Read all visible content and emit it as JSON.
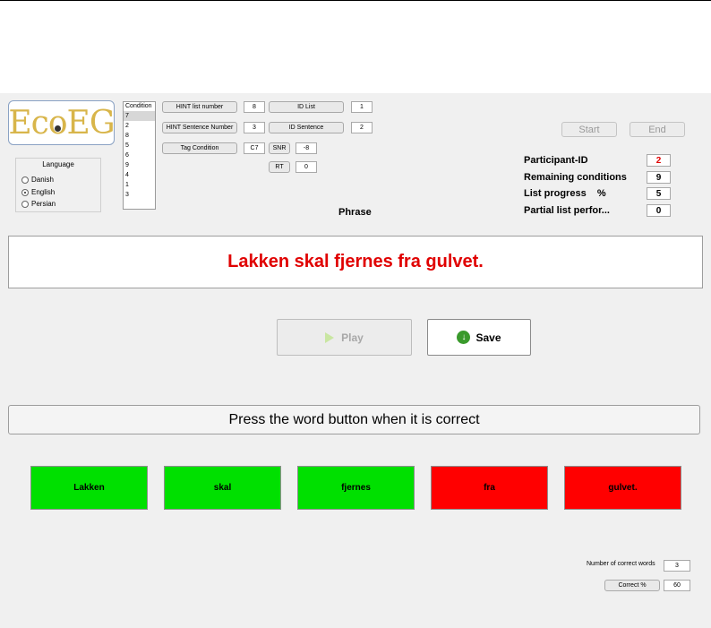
{
  "logo": {
    "text_left": "Ec",
    "text_mid": "o",
    "text_right": "EG"
  },
  "language": {
    "title": "Language",
    "options": [
      {
        "label": "Danish",
        "selected": false
      },
      {
        "label": "English",
        "selected": true
      },
      {
        "label": "Persian",
        "selected": false
      }
    ]
  },
  "conditions": {
    "header": "Condition",
    "selected": "7",
    "items": [
      "2",
      "8",
      "5",
      "6",
      "9",
      "4",
      "1",
      "3"
    ]
  },
  "params": {
    "hint_list_label": "HINT list number",
    "hint_list_value": "8",
    "id_list_label": "ID List",
    "id_list_value": "1",
    "hint_sentence_label": "HINT Sentence Number",
    "hint_sentence_value": "3",
    "id_sentence_label": "ID Sentence",
    "id_sentence_value": "2",
    "tag_condition_label": "Tag Condition",
    "tag_condition_value": "C7",
    "snr_label": "SNR",
    "snr_value": "-8",
    "rt_label": "RT",
    "rt_value": "0"
  },
  "controls": {
    "start_label": "Start",
    "end_label": "End"
  },
  "status": {
    "participant_label": "Participant-ID",
    "participant_value": "2",
    "remaining_label": "Remaining conditions",
    "remaining_value": "9",
    "progress_label": "List progress    %",
    "progress_value": "5",
    "partial_label": "Partial list perfor...",
    "partial_value": "0"
  },
  "phrase": {
    "label": "Phrase",
    "text": "Lakken skal fjernes fra gulvet."
  },
  "actions": {
    "play_label": "Play",
    "save_label": "Save"
  },
  "instruction": "Press the word button when it is correct",
  "words": [
    {
      "label": "Lakken",
      "correct": true
    },
    {
      "label": "skal",
      "correct": true
    },
    {
      "label": "fjernes",
      "correct": true
    },
    {
      "label": "fra",
      "correct": false
    },
    {
      "label": "gulvet.",
      "correct": false
    }
  ],
  "results": {
    "correct_words_label": "Number of correct words",
    "correct_words_value": "3",
    "correct_pct_label": "Correct %",
    "correct_pct_value": "60"
  },
  "colors": {
    "correct": "#00e000",
    "incorrect": "#ff0000",
    "phrase": "#e00000"
  }
}
